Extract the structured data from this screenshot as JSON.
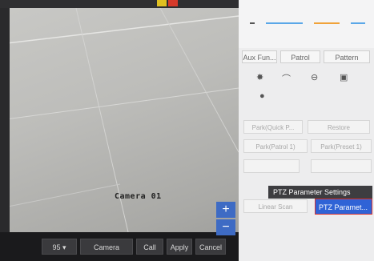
{
  "camera": {
    "osd_label": "Camera 01",
    "zoom_in": "+",
    "zoom_out": "−"
  },
  "toolbar": {
    "preset_value": "95",
    "preset_arrow": "▾",
    "camera_label": "Camera",
    "call_label": "Call",
    "apply_label": "Apply",
    "cancel_label": "Cancel"
  },
  "panel": {
    "tabs": [
      "Aux Fun...",
      "Patrol",
      "Pattern"
    ],
    "buttons": {
      "park_quick": "Park(Quick P...",
      "restore": "Restore",
      "park_patrol": "Park(Patrol 1)",
      "park_preset": "Park(Preset 1)",
      "linear_scan": "Linear Scan"
    },
    "tooltip": "PTZ Parameter Settings",
    "ptz_button": "PTZ Paramet..."
  },
  "colors": {
    "accent": "#2f63d6",
    "highlight_border": "#d63232",
    "slider_blue": "#5aa7e8",
    "slider_orange": "#f0a23a"
  }
}
